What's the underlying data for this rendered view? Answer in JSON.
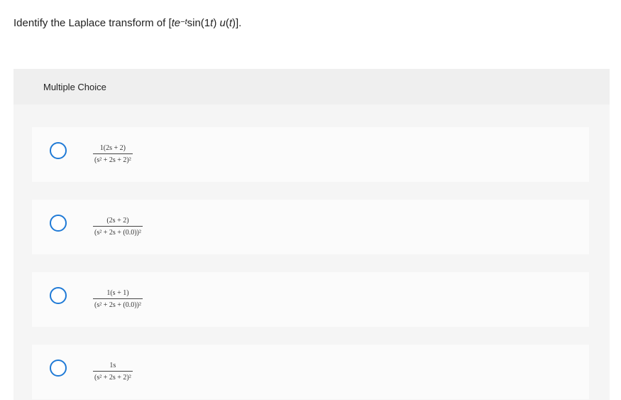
{
  "question": {
    "prefix": "Identify the Laplace transform of [",
    "t": "t",
    "e": "e",
    "exp": "−t",
    "sin": "sin(1",
    "t2": "t",
    "close1": ") ",
    "u": "u",
    "open2": "(",
    "t3": "t",
    "suffix": ")]."
  },
  "panel": {
    "header": "Multiple Choice"
  },
  "options": [
    {
      "numerator": "1(2s + 2)",
      "denominator": "(s² + 2s + 2)²"
    },
    {
      "numerator": "(2s + 2)",
      "denominator": "(s² + 2s + (0.0))²"
    },
    {
      "numerator": "1(s + 1)",
      "denominator": "(s² + 2s + (0.0))²"
    },
    {
      "numerator": "1s",
      "denominator": "(s² + 2s + 2)²"
    }
  ],
  "colors": {
    "radio_border": "#1f7ad6",
    "panel_bg": "#f5f5f5",
    "header_bg": "#efefef",
    "option_bg": "#fbfbfb"
  }
}
